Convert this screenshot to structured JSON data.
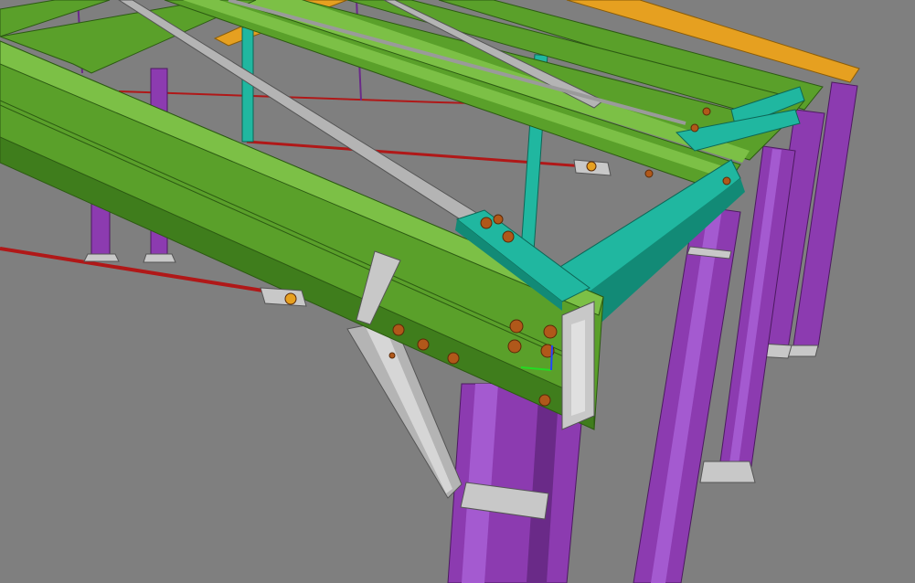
{
  "view": {
    "background": "#7f7f7f",
    "colors": {
      "column": "#8c3bb0",
      "column_dark": "#6a2a88",
      "column_light": "#a45ad0",
      "beam": "#5aa02a",
      "beam_dark": "#3f7d1c",
      "beam_light": "#7cc046",
      "purlin_yellow": "#e6a020",
      "cyan": "#20b7a0",
      "cyan_dark": "#128a76",
      "brace_grey": "#b4b4b4",
      "brace_red": "#b01818",
      "plate_grey": "#c8c8c8",
      "bolt": "#b0581a",
      "axis_x": "#22dd22",
      "axis_y": "#2244ff"
    },
    "icons": [
      "axis-triad-icon"
    ]
  }
}
